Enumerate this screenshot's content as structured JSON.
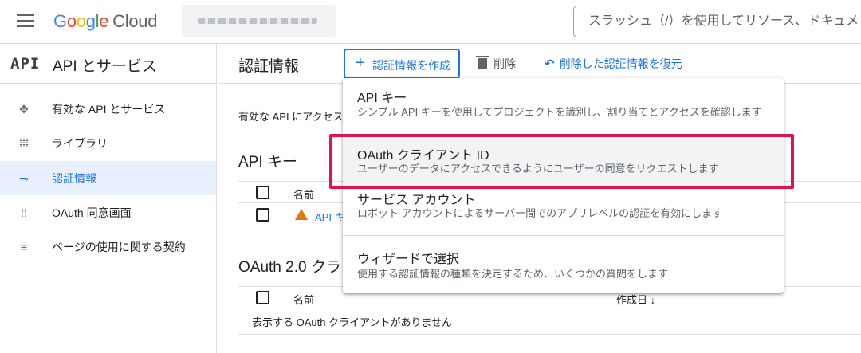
{
  "topbar": {
    "logo_parts": [
      "G",
      "o",
      "o",
      "g",
      "l",
      "e"
    ],
    "logo_suffix": "Cloud",
    "search_placeholder": "スラッシュ（/）を使用してリソース、ドキュメ"
  },
  "sidebar": {
    "icon_text": "API",
    "title": "API とサービス",
    "items": [
      {
        "label": "有効な API とサービス",
        "icon": "diamond-dots-icon"
      },
      {
        "label": "ライブラリ",
        "icon": "library-icon"
      },
      {
        "label": "認証情報",
        "icon": "key-icon",
        "active": true
      },
      {
        "label": "OAuth 同意画面",
        "icon": "dots-grid-icon"
      },
      {
        "label": "ページの使用に関する契約",
        "icon": "settings-list-icon"
      }
    ]
  },
  "header": {
    "title": "認証情報",
    "create_label": "認証情報を作成",
    "delete_label": "削除",
    "restore_label": "削除した認証情報を復元"
  },
  "main": {
    "intro_text": "有効な API にアクセス",
    "api_keys_heading": "API キー",
    "name_col": "名前",
    "api_key_link": "API キ",
    "oauth_heading": "OAuth 2.0 クラ",
    "created_col": "作成日",
    "empty_text": "表示する OAuth クライアントがありません"
  },
  "menu": {
    "items": [
      {
        "title": "API キー",
        "desc": "シンプル API キーを使用してプロジェクトを識別し、割り当てとアクセスを確認します"
      },
      {
        "title": "OAuth クライアント ID",
        "desc": "ユーザーのデータにアクセスできるようにユーザーの同意をリクエストします"
      },
      {
        "title": "サービス アカウント",
        "desc": "ロボット アカウントによるサーバー間でのアプリレベルの認証を有効にします"
      },
      {
        "title": "ウィザードで選択",
        "desc": "使用する認証情報の種類を決定するため、いくつかの質問をします"
      }
    ]
  },
  "colors": {
    "accent": "#1a73e8",
    "highlight": "#e3124d",
    "warning": "#e37400"
  }
}
